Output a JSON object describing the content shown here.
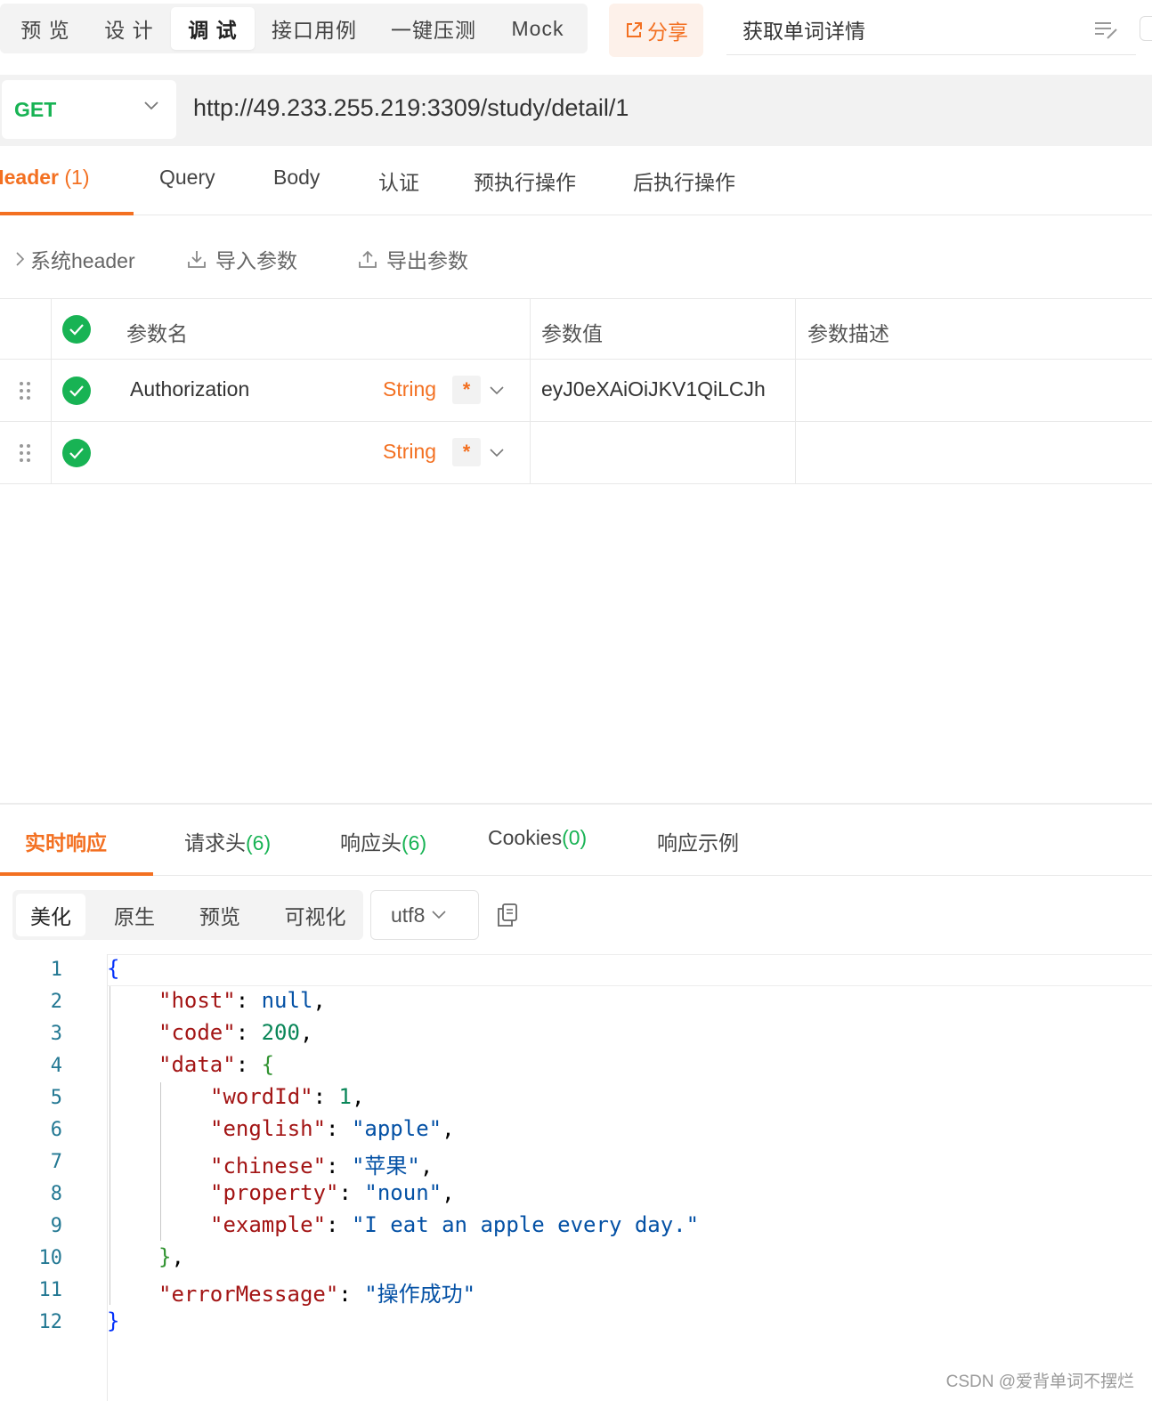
{
  "top_tabs": [
    "预 览",
    "设 计",
    "调 试",
    "接口用例",
    "一键压测",
    "Mock"
  ],
  "share_label": "分享",
  "api_name": "获取单词详情",
  "request": {
    "method": "GET",
    "url": "http://49.233.255.219:3309/study/detail/1"
  },
  "req_tabs": {
    "header": "Header",
    "header_count": "(1)",
    "query": "Query",
    "body": "Body",
    "auth": "认证",
    "pre": "预执行操作",
    "post": "后执行操作"
  },
  "actions": {
    "system_header": "系统header",
    "import": "导入参数",
    "export": "导出参数"
  },
  "param_table": {
    "col_name": "参数名",
    "col_value": "参数值",
    "col_desc": "参数描述",
    "rows": [
      {
        "name": "Authorization",
        "type": "String",
        "required": "*",
        "value": "eyJ0eXAiOiJKV1QiLCJh",
        "desc": ""
      },
      {
        "name": "",
        "type": "String",
        "required": "*",
        "value": "",
        "desc": ""
      }
    ]
  },
  "resp_tabs": {
    "realtime": "实时响应",
    "req_headers": "请求头",
    "req_headers_count": "(6)",
    "resp_headers": "响应头",
    "resp_headers_count": "(6)",
    "cookies": "Cookies",
    "cookies_count": "(0)",
    "example": "响应示例"
  },
  "format": {
    "pretty": "美化",
    "raw": "原生",
    "preview": "预览",
    "visual": "可视化",
    "encoding": "utf8"
  },
  "code_line_numbers": [
    "1",
    "2",
    "3",
    "4",
    "5",
    "6",
    "7",
    "8",
    "9",
    "10",
    "11",
    "12"
  ],
  "response_json": {
    "host_key": "\"host\"",
    "host_val": "null",
    "code_key": "\"code\"",
    "code_val": "200",
    "data_key": "\"data\"",
    "wordId_key": "\"wordId\"",
    "wordId_val": "1",
    "english_key": "\"english\"",
    "english_val": "\"apple\"",
    "chinese_key": "\"chinese\"",
    "chinese_val": "\"苹果\"",
    "property_key": "\"property\"",
    "property_val": "\"noun\"",
    "example_key": "\"example\"",
    "example_val": "\"I eat an apple every day.\"",
    "errorMessage_key": "\"errorMessage\"",
    "errorMessage_val": "\"操作成功\""
  },
  "watermark": "CSDN @爱背单词不摆烂",
  "colors": {
    "accent": "#f37021",
    "success": "#18b354"
  }
}
